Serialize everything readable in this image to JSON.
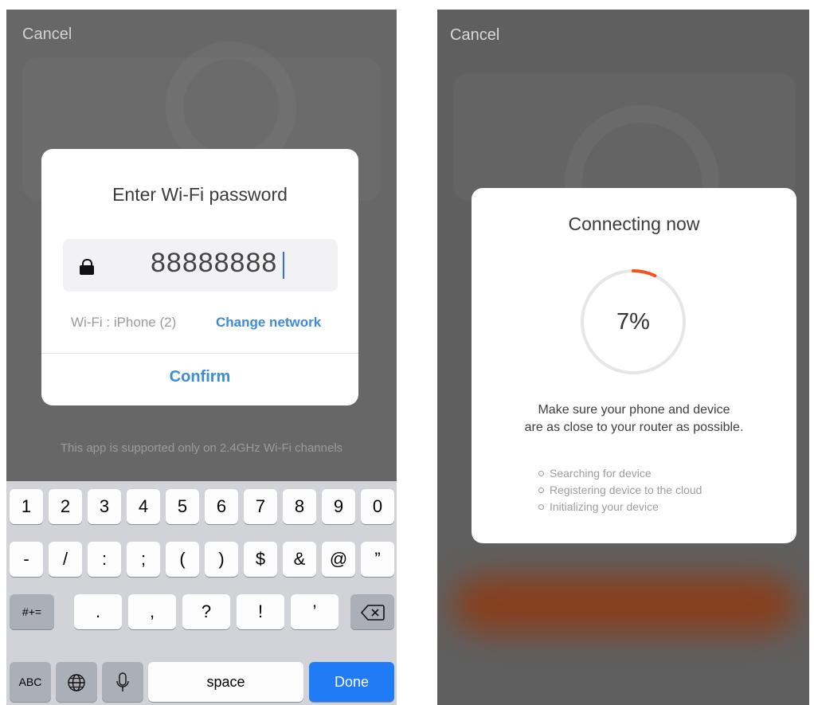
{
  "left_screen": {
    "cancel_label": "Cancel",
    "dialog": {
      "title": "Enter Wi-Fi password",
      "password_value": "88888888",
      "wifi_label": "Wi-Fi : iPhone (2)",
      "change_network_label": "Change network",
      "confirm_label": "Confirm"
    },
    "notice": "This app is supported only on 2.4GHz Wi-Fi channels",
    "keyboard": {
      "row1": [
        "1",
        "2",
        "3",
        "4",
        "5",
        "6",
        "7",
        "8",
        "9",
        "0"
      ],
      "row2": [
        "-",
        "/",
        ":",
        ";",
        "(",
        ")",
        "$",
        "&",
        "@",
        "”"
      ],
      "row3_left": "#+=",
      "row3": [
        ".",
        ",",
        "?",
        "!",
        "’"
      ],
      "abc_label": "ABC",
      "space_label": "space",
      "done_label": "Done",
      "done_color": "#1f7cf6"
    }
  },
  "right_screen": {
    "cancel_label": "Cancel",
    "card": {
      "title": "Connecting now",
      "progress_percent": 7,
      "progress_label": "7%",
      "progress_color": "#f0531c",
      "hint_line1": "Make sure your phone and device",
      "hint_line2": "are as close to your router as possible.",
      "steps": [
        "Searching for device",
        "Registering device to the cloud",
        "Initializing your device"
      ]
    }
  },
  "icons": {
    "lock": "lock-icon",
    "globe": "globe-icon",
    "microphone": "microphone-icon",
    "backspace": "backspace-icon"
  }
}
